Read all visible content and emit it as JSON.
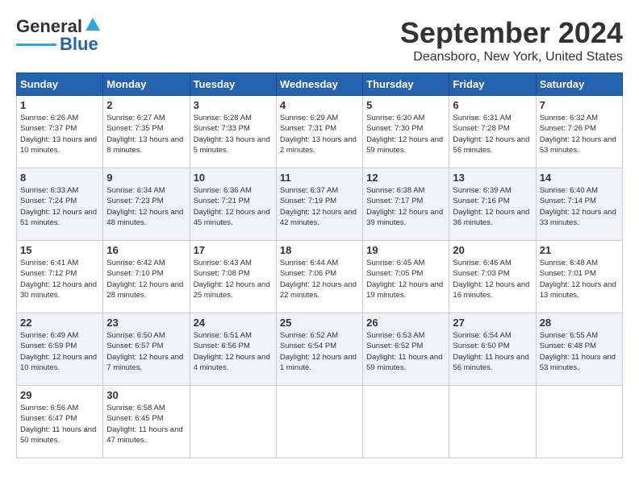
{
  "header": {
    "logo_text1": "General",
    "logo_text2": "Blue",
    "title": "September 2024",
    "subtitle": "Deansboro, New York, United States"
  },
  "calendar": {
    "days_of_week": [
      "Sunday",
      "Monday",
      "Tuesday",
      "Wednesday",
      "Thursday",
      "Friday",
      "Saturday"
    ],
    "weeks": [
      [
        null,
        {
          "day": 2,
          "sunrise": "6:27 AM",
          "sunset": "7:35 PM",
          "daylight": "13 hours and 8 minutes."
        },
        {
          "day": 3,
          "sunrise": "6:28 AM",
          "sunset": "7:33 PM",
          "daylight": "13 hours and 5 minutes."
        },
        {
          "day": 4,
          "sunrise": "6:29 AM",
          "sunset": "7:31 PM",
          "daylight": "13 hours and 2 minutes."
        },
        {
          "day": 5,
          "sunrise": "6:30 AM",
          "sunset": "7:30 PM",
          "daylight": "12 hours and 59 minutes."
        },
        {
          "day": 6,
          "sunrise": "6:31 AM",
          "sunset": "7:28 PM",
          "daylight": "12 hours and 56 minutes."
        },
        {
          "day": 7,
          "sunrise": "6:32 AM",
          "sunset": "7:26 PM",
          "daylight": "12 hours and 53 minutes."
        }
      ],
      [
        {
          "day": 1,
          "sunrise": "6:26 AM",
          "sunset": "7:37 PM",
          "daylight": "13 hours and 10 minutes."
        },
        {
          "day": 8,
          "sunrise": "Sunrise: 6:33 AM",
          "sunset": "7:24 PM",
          "daylight": "12 hours and 51 minutes."
        },
        {
          "day": 9,
          "sunrise": "6:34 AM",
          "sunset": "7:23 PM",
          "daylight": "12 hours and 48 minutes."
        },
        {
          "day": 10,
          "sunrise": "6:36 AM",
          "sunset": "7:21 PM",
          "daylight": "12 hours and 45 minutes."
        },
        {
          "day": 11,
          "sunrise": "6:37 AM",
          "sunset": "7:19 PM",
          "daylight": "12 hours and 42 minutes."
        },
        {
          "day": 12,
          "sunrise": "6:38 AM",
          "sunset": "7:17 PM",
          "daylight": "12 hours and 39 minutes."
        },
        {
          "day": 13,
          "sunrise": "6:39 AM",
          "sunset": "7:16 PM",
          "daylight": "12 hours and 36 minutes."
        },
        {
          "day": 14,
          "sunrise": "6:40 AM",
          "sunset": "7:14 PM",
          "daylight": "12 hours and 33 minutes."
        }
      ],
      [
        {
          "day": 15,
          "sunrise": "6:41 AM",
          "sunset": "7:12 PM",
          "daylight": "12 hours and 30 minutes."
        },
        {
          "day": 16,
          "sunrise": "6:42 AM",
          "sunset": "7:10 PM",
          "daylight": "12 hours and 28 minutes."
        },
        {
          "day": 17,
          "sunrise": "6:43 AM",
          "sunset": "7:08 PM",
          "daylight": "12 hours and 25 minutes."
        },
        {
          "day": 18,
          "sunrise": "6:44 AM",
          "sunset": "7:06 PM",
          "daylight": "12 hours and 22 minutes."
        },
        {
          "day": 19,
          "sunrise": "6:45 AM",
          "sunset": "7:05 PM",
          "daylight": "12 hours and 19 minutes."
        },
        {
          "day": 20,
          "sunrise": "6:46 AM",
          "sunset": "7:03 PM",
          "daylight": "12 hours and 16 minutes."
        },
        {
          "day": 21,
          "sunrise": "6:48 AM",
          "sunset": "7:01 PM",
          "daylight": "12 hours and 13 minutes."
        }
      ],
      [
        {
          "day": 22,
          "sunrise": "6:49 AM",
          "sunset": "6:59 PM",
          "daylight": "12 hours and 10 minutes."
        },
        {
          "day": 23,
          "sunrise": "6:50 AM",
          "sunset": "6:57 PM",
          "daylight": "12 hours and 7 minutes."
        },
        {
          "day": 24,
          "sunrise": "6:51 AM",
          "sunset": "6:56 PM",
          "daylight": "12 hours and 4 minutes."
        },
        {
          "day": 25,
          "sunrise": "6:52 AM",
          "sunset": "6:54 PM",
          "daylight": "12 hours and 1 minute."
        },
        {
          "day": 26,
          "sunrise": "6:53 AM",
          "sunset": "6:52 PM",
          "daylight": "11 hours and 59 minutes."
        },
        {
          "day": 27,
          "sunrise": "6:54 AM",
          "sunset": "6:50 PM",
          "daylight": "11 hours and 56 minutes."
        },
        {
          "day": 28,
          "sunrise": "6:55 AM",
          "sunset": "6:48 PM",
          "daylight": "11 hours and 53 minutes."
        }
      ],
      [
        {
          "day": 29,
          "sunrise": "6:56 AM",
          "sunset": "6:47 PM",
          "daylight": "11 hours and 50 minutes."
        },
        {
          "day": 30,
          "sunrise": "6:58 AM",
          "sunset": "6:45 PM",
          "daylight": "11 hours and 47 minutes."
        },
        null,
        null,
        null,
        null,
        null
      ]
    ]
  }
}
